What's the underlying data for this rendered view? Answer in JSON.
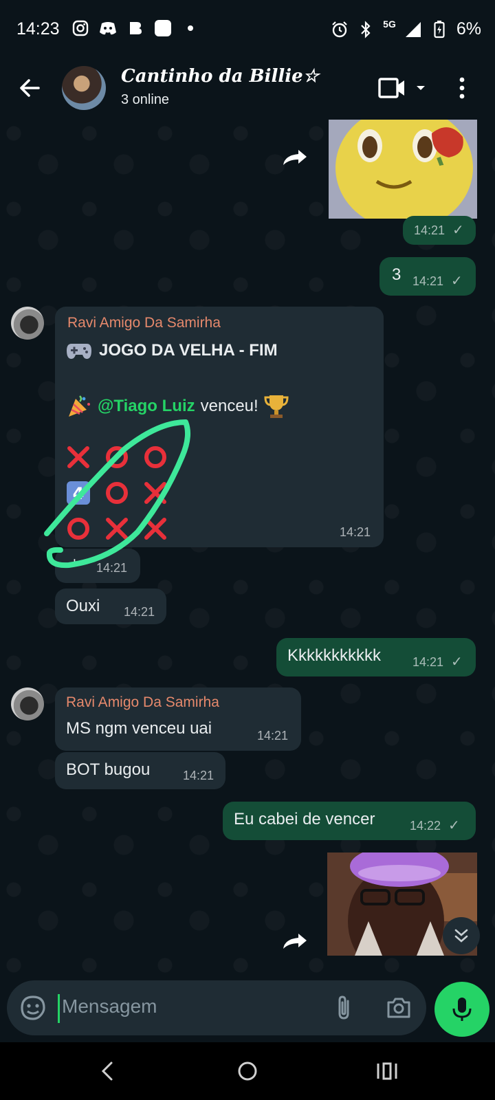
{
  "status_bar": {
    "time": "14:23",
    "network": "5G",
    "battery": "6%",
    "icons": [
      "instagram-icon",
      "discord-icon",
      "b-icon",
      "app-icon",
      "dot-icon",
      "alarm-icon",
      "bluetooth-icon",
      "signal-icon",
      "battery-icon"
    ]
  },
  "header": {
    "title": "Cantinho da Billie☆",
    "subtitle": "3 online"
  },
  "messages": {
    "m1_time": "14:21",
    "m2_text": "3",
    "m2_time": "14:21",
    "m3_sender": "Ravi Amigo Da Samirha",
    "m3_title": "JOGO DA VELHA - FIM",
    "m3_winner_mention": "@Tiago Luiz",
    "m3_winner_text": " venceu!",
    "m3_board": [
      [
        "❌",
        "⭕",
        "⭕"
      ],
      [
        "4️⃣",
        "⭕",
        "❌"
      ],
      [
        "⭕",
        "❌",
        "❌"
      ]
    ],
    "m3_time": "14:21",
    "m4_text": "+",
    "m4_time": "14:21",
    "m5_text": "Ouxi",
    "m5_time": "14:21",
    "m6_text": "Kkkkkkkkkkk",
    "m6_time": "14:21",
    "m7_sender": "Ravi Amigo Da Samirha",
    "m7_text": "MS ngm venceu uai",
    "m7_time": "14:21",
    "m8_text": "BOT bugou",
    "m8_time": "14:21",
    "m9_text": "Eu cabei de vencer",
    "m9_time": "14:22"
  },
  "input": {
    "placeholder": "Mensagem"
  },
  "colors": {
    "outgoing_bubble": "#144d37",
    "incoming_bubble": "#1f2c34",
    "accent": "#25d366",
    "sender_name": "#e6896c",
    "mention": "#25d366"
  }
}
